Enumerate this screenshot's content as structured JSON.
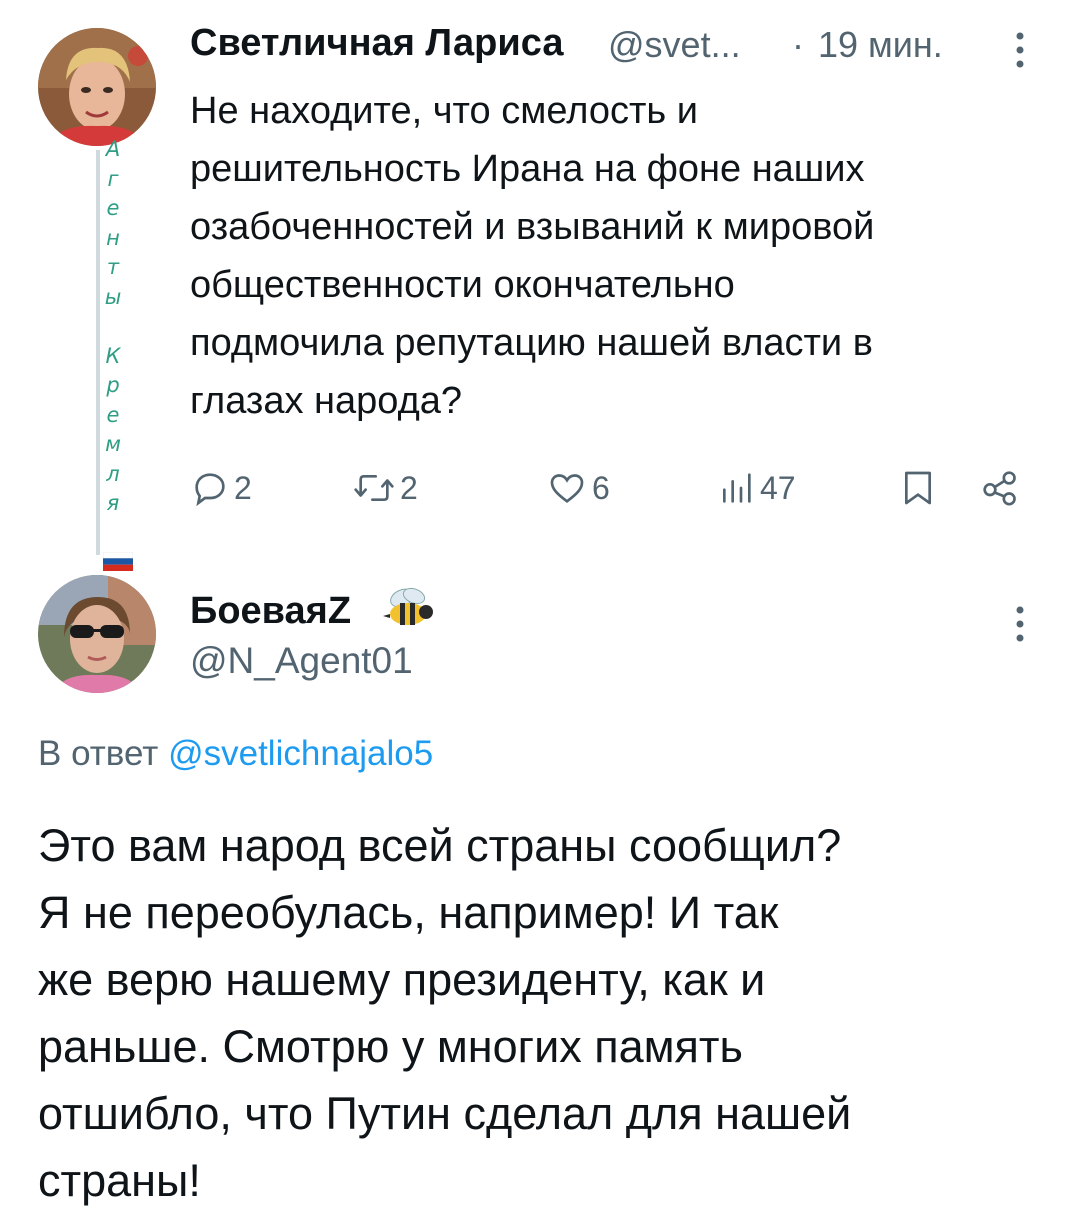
{
  "tweet1": {
    "author_name": "Светличная Лариса",
    "handle": "@svet...",
    "separator": "·",
    "time": "19 мин.",
    "text": "Не находите, что смелость и\nрешительность Ирана на фоне наших\nозабоченностей и  взываний к мировой\nобщественности окончательно\nподмочила репутацию нашей власти в\nглазах народа?",
    "vertical_label": "А\nг\nе\nн\nт\nы\n \nК\nр\nе\nм\nл\nя",
    "actions": {
      "replies": "2",
      "retweets": "2",
      "likes": "6",
      "views": "47"
    }
  },
  "tweet2": {
    "author_name": "БоеваяZ",
    "handle": "@N_Agent01",
    "reply_prefix": "В ответ",
    "reply_mention": "@svetlichnajalo5",
    "text": "Это вам народ всей страны сообщил?\nЯ не переобулась, например! И так\nже верю нашему президенту, как и\nраньше. Смотрю у многих память\nотшибло, что Путин сделал для нашей\nстраны!"
  },
  "icons": {
    "reply": "reply-icon",
    "retweet": "retweet-icon",
    "like": "heart-icon",
    "views": "views-icon",
    "bookmark": "bookmark-icon",
    "share": "share-icon",
    "more": "more-vertical-icon",
    "bee": "bee-emoji-icon",
    "flag": "russian-flag-icon"
  },
  "colors": {
    "text": "#0f1419",
    "secondary": "#536471",
    "link": "#1d9bf0",
    "vertical_label": "#2f9e84",
    "thread_line": "#cfd9de"
  }
}
